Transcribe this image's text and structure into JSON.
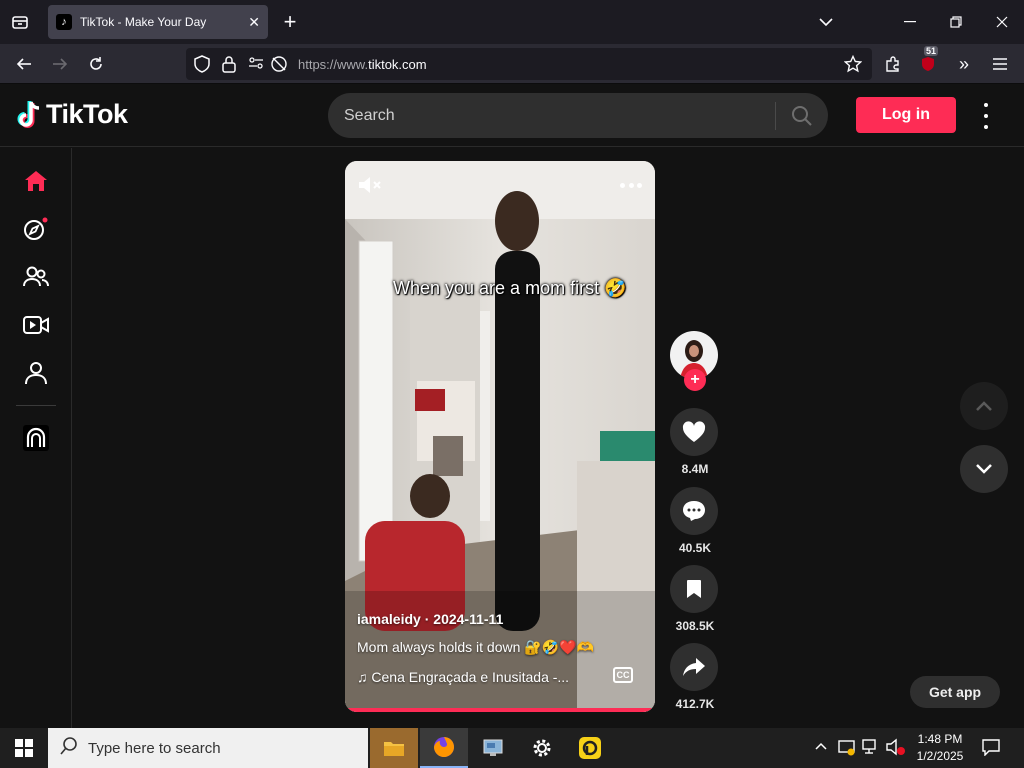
{
  "browser": {
    "tab_title": "TikTok - Make Your Day",
    "url_prefix": "https://www.",
    "url_domain": "tiktok.com",
    "extension_badge": "51"
  },
  "header": {
    "logo_text": "TikTok",
    "search_placeholder": "Search",
    "login_label": "Log in"
  },
  "sidebar": {
    "items": [
      {
        "icon": "home-icon",
        "active": true
      },
      {
        "icon": "explore-icon",
        "has_dot": true
      },
      {
        "icon": "following-icon"
      },
      {
        "icon": "live-icon"
      },
      {
        "icon": "profile-icon"
      },
      {
        "icon": "app-logo-icon"
      }
    ]
  },
  "video": {
    "overlay_text": "When you are a mom first 🤣",
    "author": "iamaleidy",
    "date": "2024-11-11",
    "description": "Mom always holds it down 🔐🤣❤️🫶",
    "music": "Cena Engraçada e Inusitada -...",
    "progress": 0.99
  },
  "actions": {
    "likes": "8.4M",
    "comments": "40.5K",
    "saves": "308.5K",
    "shares": "412.7K"
  },
  "get_app_label": "Get app",
  "taskbar": {
    "search_placeholder": "Type here to search",
    "time": "1:48 PM",
    "date": "1/2/2025"
  },
  "colors": {
    "brand": "#fe2c55",
    "background": "#121212",
    "surface": "#2f2f2f"
  }
}
